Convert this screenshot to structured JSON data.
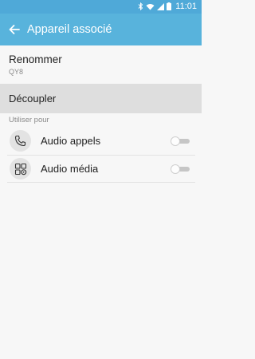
{
  "status_bar": {
    "time": "11:01",
    "icons": [
      "bluetooth-icon",
      "wifi-icon",
      "signal-icon",
      "battery-icon"
    ]
  },
  "app_bar": {
    "title": "Appareil associé",
    "back_icon": "back-arrow-icon"
  },
  "rename": {
    "title": "Renommer",
    "device_name": "QY8"
  },
  "unpair": {
    "label": "Découpler"
  },
  "use_for": {
    "header": "Utiliser pour",
    "items": [
      {
        "label": "Audio appels",
        "icon": "phone-icon",
        "enabled": false
      },
      {
        "label": "Audio média",
        "icon": "media-icon",
        "enabled": false
      }
    ]
  },
  "colors": {
    "accent": "#58b3dc",
    "status_bar": "#4fa9d8",
    "background": "#f7f7f7",
    "pressed_row": "#dedede"
  }
}
